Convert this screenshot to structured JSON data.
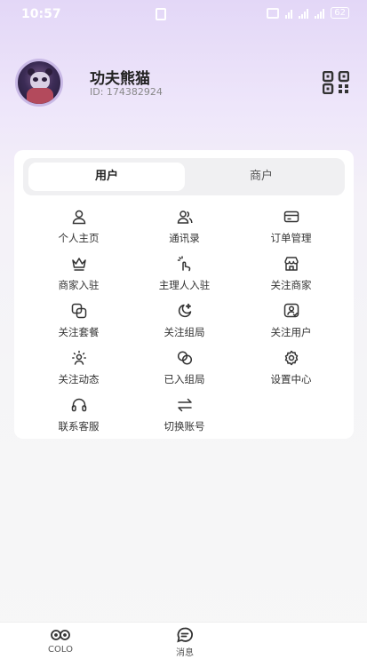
{
  "status_bar": {
    "time": "10:57",
    "battery": "62"
  },
  "profile": {
    "name": "功夫熊猫",
    "id_text": "ID: 174382924"
  },
  "tabs": [
    {
      "label": "用户",
      "active": true
    },
    {
      "label": "商户",
      "active": false
    }
  ],
  "menu": [
    {
      "label": "个人主页",
      "icon": "user-icon"
    },
    {
      "label": "通讯录",
      "icon": "contacts-icon"
    },
    {
      "label": "订单管理",
      "icon": "card-icon"
    },
    {
      "label": "商家入驻",
      "icon": "crown-icon"
    },
    {
      "label": "主理人入驻",
      "icon": "hand-sparkle-icon"
    },
    {
      "label": "关注商家",
      "icon": "shop-icon"
    },
    {
      "label": "关注套餐",
      "icon": "package-icon"
    },
    {
      "label": "关注组局",
      "icon": "moon-star-icon"
    },
    {
      "label": "关注用户",
      "icon": "user-check-icon"
    },
    {
      "label": "关注动态",
      "icon": "feed-icon"
    },
    {
      "label": "已入组局",
      "icon": "rings-icon"
    },
    {
      "label": "设置中心",
      "icon": "gear-icon"
    },
    {
      "label": "联系客服",
      "icon": "headset-icon"
    },
    {
      "label": "切换账号",
      "icon": "switch-arrows-icon"
    }
  ],
  "bottom_nav": [
    {
      "label": "COLO",
      "icon": "colo-icon"
    },
    {
      "label": "消息",
      "icon": "message-icon"
    }
  ]
}
